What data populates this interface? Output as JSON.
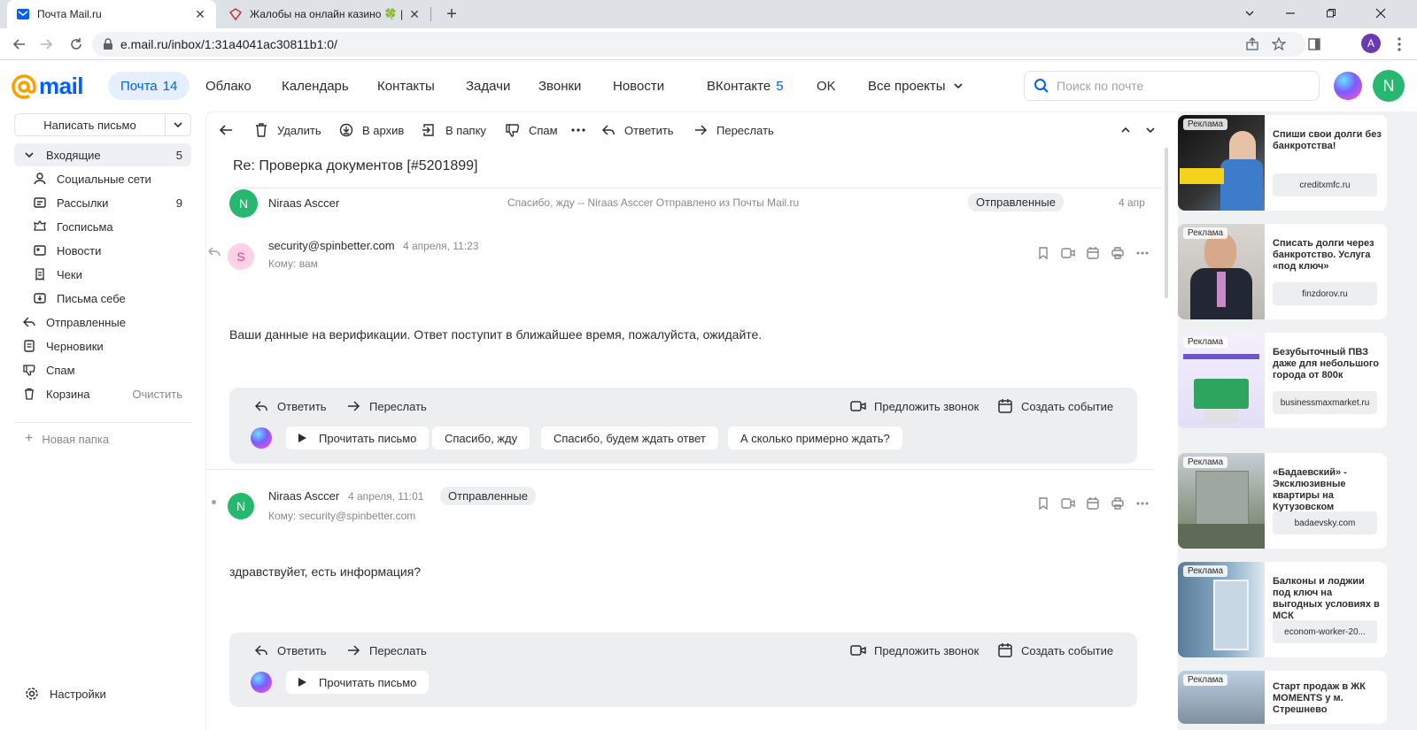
{
  "browser": {
    "tabs": [
      {
        "title": "Почта Mail.ru"
      },
      {
        "title": "Жалобы на онлайн казино 🍀 |"
      }
    ],
    "url": "e.mail.ru/inbox/1:31a4041ac30811b1:0/",
    "profile_letter": "A"
  },
  "header": {
    "logo_text": "mail",
    "nav": [
      {
        "label": "Почта",
        "count": "14"
      },
      {
        "label": "Облако"
      },
      {
        "label": "Календарь"
      },
      {
        "label": "Контакты"
      },
      {
        "label": "Задачи"
      },
      {
        "label": "Звонки"
      },
      {
        "label": "Новости"
      },
      {
        "label": "ВКонтакте",
        "count": "5"
      },
      {
        "label": "OK"
      },
      {
        "label": "Все проекты"
      }
    ],
    "search_placeholder": "Поиск по почте",
    "user_letter": "N"
  },
  "sidebar": {
    "compose": "Написать письмо",
    "folders": [
      {
        "label": "Входящие",
        "count": "5"
      },
      {
        "label": "Социальные сети"
      },
      {
        "label": "Рассылки",
        "count": "9"
      },
      {
        "label": "Госписьма"
      },
      {
        "label": "Новости"
      },
      {
        "label": "Чеки"
      },
      {
        "label": "Письма себе"
      },
      {
        "label": "Отправленные"
      },
      {
        "label": "Черновики"
      },
      {
        "label": "Спам"
      },
      {
        "label": "Корзина",
        "action": "Очистить"
      }
    ],
    "new_folder": "Новая папка",
    "settings": "Настройки"
  },
  "toolbar": {
    "delete": "Удалить",
    "archive": "В архив",
    "to_folder": "В папку",
    "spam": "Спам",
    "reply": "Ответить",
    "forward": "Переслать"
  },
  "thread": {
    "subject": "Re: Проверка документов [#5201899]",
    "collapsed": {
      "avatar": "N",
      "sender": "Niraas Asccer",
      "snippet": "Спасибо, жду -- Niraas Asccer Отправлено из Почты Mail.ru",
      "badge": "Отправленные",
      "date": "4 апр"
    },
    "messages": [
      {
        "avatar": "S",
        "sender": "security@spinbetter.com",
        "date": "4 апреля, 11:23",
        "to": "Кому: вам",
        "body": "Ваши данные на верификации. Ответ поступит в ближайшее время, пожалуйста, ожидайте.",
        "actions": {
          "reply": "Ответить",
          "forward": "Переслать",
          "call": "Предложить звонок",
          "event": "Создать событие"
        },
        "chips": [
          "Прочитать письмо",
          "Спасибо, жду",
          "Спасибо, будем ждать ответ",
          "А сколько примерно ждать?"
        ]
      },
      {
        "avatar": "N",
        "sender": "Niraas Asccer",
        "date": "4 апреля, 11:01",
        "badge": "Отправленные",
        "to": "Кому: security@spinbetter.com",
        "body": "здравствуйет, есть информация?",
        "actions": {
          "reply": "Ответить",
          "forward": "Переслать",
          "call": "Предложить звонок",
          "event": "Создать событие"
        },
        "chips": [
          "Прочитать письмо"
        ]
      }
    ]
  },
  "ads": {
    "label": "Реклама",
    "items": [
      {
        "title": "Спиши свои долги без банкротства!",
        "link": "creditxmfc.ru"
      },
      {
        "title": "Списать долги через банкротство. Услуга «под ключ»",
        "link": "finzdorov.ru"
      },
      {
        "title": "Безубыточный ПВЗ даже для небольшого города от 800к",
        "link": "businessmaxmarket.ru"
      },
      {
        "title": "«Бадаевский» - Эксклюзивные квартиры на Кутузовском",
        "link": "badaevsky.com"
      },
      {
        "title": "Балконы и лоджии под ключ на выгодных условиях в МСК",
        "link": "econom-worker-20..."
      },
      {
        "title": "Старт продаж в ЖК MOMENTS у м. Стрешнево",
        "link": ""
      }
    ]
  },
  "colors": {
    "accent": "#005ff9",
    "avatar_green": "#27b86f",
    "avatar_pink": "#ffd1e6"
  }
}
